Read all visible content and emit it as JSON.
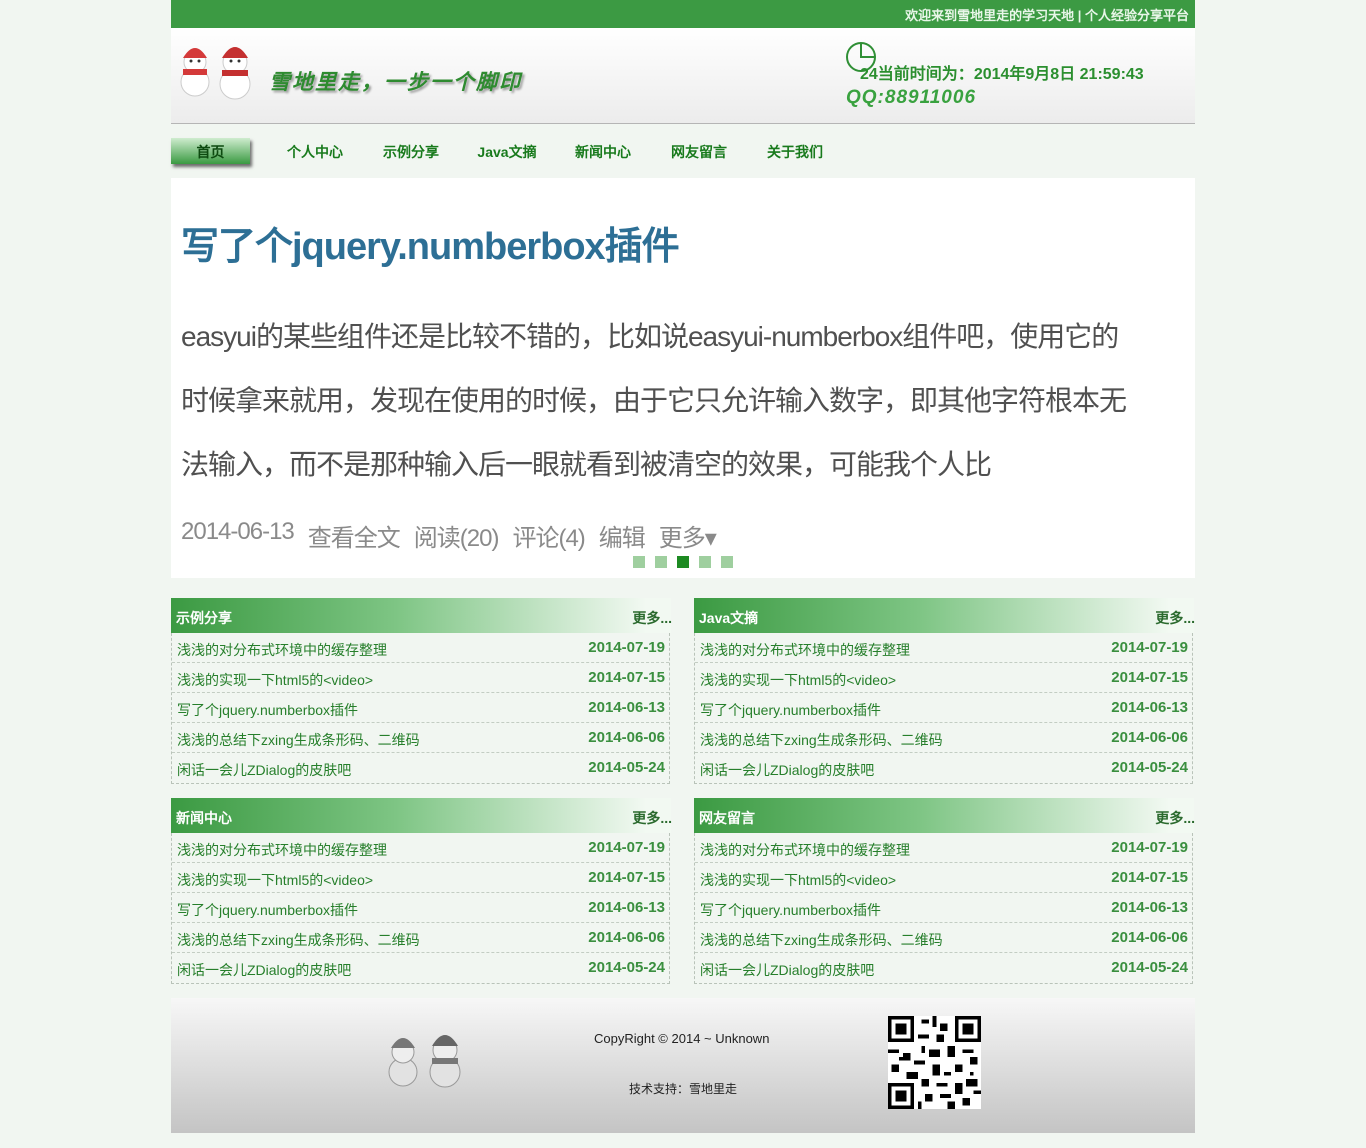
{
  "topbar": {
    "text": "欢迎来到雪地里走的学习天地 | 个人经验分享平台"
  },
  "header": {
    "logo_icon": "snowman-logo",
    "slogan": "雪地里走，一步一个脚印",
    "clock_number": "24",
    "time_label": "当前时间为：",
    "time_value": "2014年9月8日 21:59:43",
    "qq": "QQ:88911006"
  },
  "nav": {
    "items": [
      "首页",
      "个人中心",
      "示例分享",
      "Java文摘",
      "新闻中心",
      "网友留言",
      "关于我们"
    ],
    "active": "首页"
  },
  "banner": {
    "title": "写了个jquery.numberbox插件",
    "text": "easyui的某些组件还是比较不错的，比如说easyui-numberbox组件吧，使用它的时候拿来就用，发现在使用的时候，由于它只允许输入数字，即其他字符根本无法输入，而不是那种输入后一眼就看到被清空的效果，可能我个人比",
    "meta": [
      "2014-06-13",
      "查看全文",
      "阅读(20)",
      "评论(4)",
      "编辑",
      "更多▾"
    ],
    "dot_count": 5,
    "active_dot": 3
  },
  "panels": [
    {
      "title": "示例分享",
      "more": "更多...",
      "items": [
        {
          "title": "浅浅的对分布式环境中的缓存整理",
          "date": "2014-07-19"
        },
        {
          "title": "浅浅的实现一下html5的<video>",
          "date": "2014-07-15"
        },
        {
          "title": "写了个jquery.numberbox插件",
          "date": "2014-06-13"
        },
        {
          "title": "浅浅的总结下zxing生成条形码、二维码",
          "date": "2014-06-06"
        },
        {
          "title": "闲话一会儿ZDialog的皮肤吧",
          "date": "2014-05-24"
        }
      ]
    },
    {
      "title": "Java文摘",
      "more": "更多...",
      "items": [
        {
          "title": "浅浅的对分布式环境中的缓存整理",
          "date": "2014-07-19"
        },
        {
          "title": "浅浅的实现一下html5的<video>",
          "date": "2014-07-15"
        },
        {
          "title": "写了个jquery.numberbox插件",
          "date": "2014-06-13"
        },
        {
          "title": "浅浅的总结下zxing生成条形码、二维码",
          "date": "2014-06-06"
        },
        {
          "title": "闲话一会儿ZDialog的皮肤吧",
          "date": "2014-05-24"
        }
      ]
    },
    {
      "title": "新闻中心",
      "more": "更多...",
      "items": [
        {
          "title": "浅浅的对分布式环境中的缓存整理",
          "date": "2014-07-19"
        },
        {
          "title": "浅浅的实现一下html5的<video>",
          "date": "2014-07-15"
        },
        {
          "title": "写了个jquery.numberbox插件",
          "date": "2014-06-13"
        },
        {
          "title": "浅浅的总结下zxing生成条形码、二维码",
          "date": "2014-06-06"
        },
        {
          "title": "闲话一会儿ZDialog的皮肤吧",
          "date": "2014-05-24"
        }
      ]
    },
    {
      "title": "网友留言",
      "more": "更多...",
      "items": [
        {
          "title": "浅浅的对分布式环境中的缓存整理",
          "date": "2014-07-19"
        },
        {
          "title": "浅浅的实现一下html5的<video>",
          "date": "2014-07-15"
        },
        {
          "title": "写了个jquery.numberbox插件",
          "date": "2014-06-13"
        },
        {
          "title": "浅浅的总结下zxing生成条形码、二维码",
          "date": "2014-06-06"
        },
        {
          "title": "闲话一会儿ZDialog的皮肤吧",
          "date": "2014-05-24"
        }
      ]
    }
  ],
  "footer": {
    "logo_icon": "snowman-logo-gray",
    "copyright": "CopyRight © 2014 ~ Unknown",
    "support": "技术支持：雪地里走",
    "qr_icon": "qr-code"
  },
  "colors": {
    "brand_green": "#3c9a43",
    "text_green": "#267f2b",
    "link_blue": "#2d6f95"
  }
}
